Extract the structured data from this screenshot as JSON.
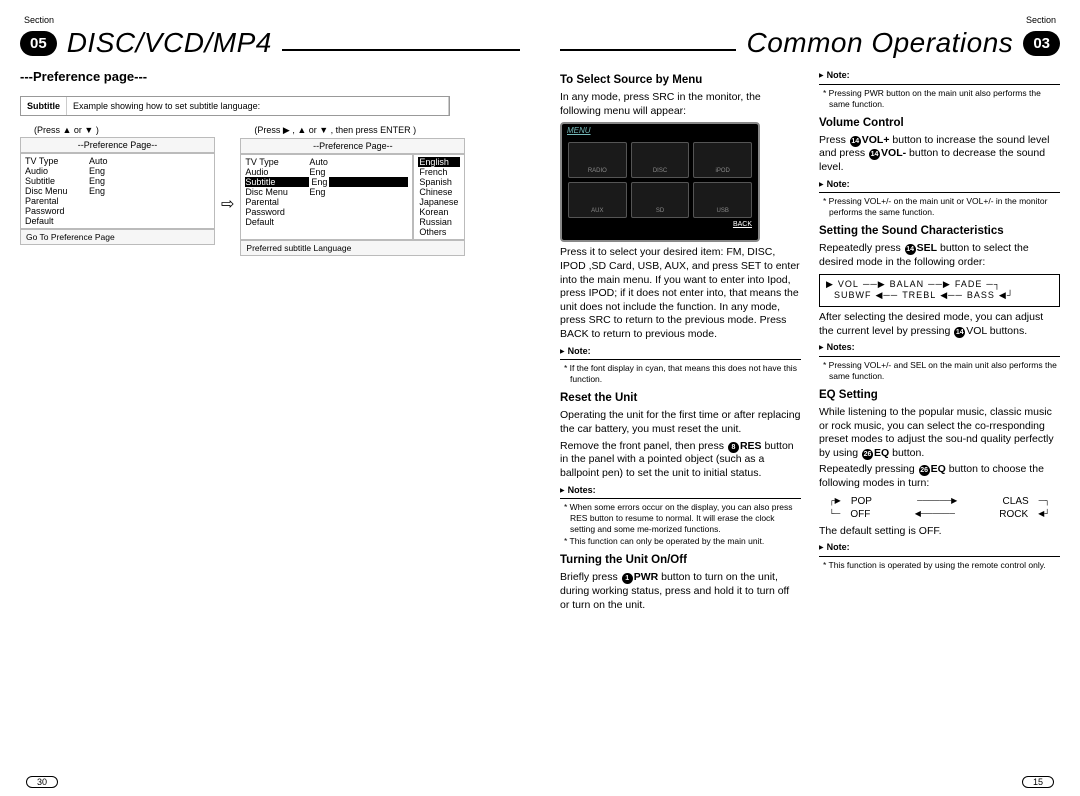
{
  "left": {
    "section_label": "Section",
    "section_number": "05",
    "title": "DISC/VCD/MP4",
    "pref_header": "---Preference page---",
    "subtitle_label": "Subtitle",
    "subtitle_desc": "Example showing how to set subtitle language:",
    "press1": "(Press ▲ or ▼ )",
    "press2": "(Press ▶ , ▲ or ▼ , then press ENTER )",
    "panel1": {
      "head": "--Preference Page--",
      "rows": [
        [
          "TV Type",
          "Auto"
        ],
        [
          "Audio",
          "Eng"
        ],
        [
          "Subtitle",
          "Eng"
        ],
        [
          "Disc Menu",
          "Eng"
        ],
        [
          "Parental",
          ""
        ],
        [
          "Password",
          ""
        ],
        [
          "Default",
          ""
        ]
      ],
      "foot": "Go To Preference Page"
    },
    "panel2": {
      "head": "--Preference Page--",
      "rows": [
        [
          "TV Type",
          "Auto"
        ],
        [
          "Audio",
          "Eng"
        ],
        [
          "Subtitle",
          "Eng"
        ],
        [
          "Disc Menu",
          "Eng"
        ],
        [
          "Parental",
          ""
        ],
        [
          "Password",
          ""
        ],
        [
          "Default",
          ""
        ]
      ],
      "foot": "Preferred subtitle Language",
      "langs": [
        "English",
        "French",
        "Spanish",
        "Chinese",
        "Japanese",
        "Korean",
        "Russian",
        "Others"
      ]
    },
    "page_num": "30"
  },
  "right": {
    "section_label": "Section",
    "section_number": "03",
    "title": "Common Operations",
    "page_num": "15",
    "col1": {
      "h1": "To Select Source by Menu",
      "p1": "In any mode, press SRC in the monitor, the following menu will appear:",
      "menu_label": "MENU",
      "tiles": [
        "RADIO",
        "DISC",
        "iPOD",
        "AUX",
        "SD",
        "USB"
      ],
      "back": "BACK",
      "p2": "Press it to select your desired item: FM, DISC, IPOD ,SD Card, USB, AUX, and press SET to enter into the main menu. If you want to enter into Ipod, press IPOD; if it does not enter into, that means the unit does not include the function. In any mode, press SRC  to return to the previous mode. Press BACK to return to previous mode.",
      "note_l": "Note:",
      "note1": "*   If the font display in cyan, that means this does not have this function.",
      "h2": "Reset the Unit",
      "p3": "Operating the unit for the first time or after replacing the car battery, you must reset the unit.",
      "p4a": "Remove the front panel, then press ",
      "p4b": " button in the panel with a pointed object (such as a ballpoint pen) to set the unit to initial status.",
      "res_num": "8",
      "res_label": "RES",
      "notes_l": "Notes:",
      "note2a": "*   When some errors occur on the display, you can also press RES button to resume to normal. It will erase the clock setting and some me-morized functions.",
      "note2b": "*   This function can only be operated by the main unit.",
      "h3": "Turning the Unit On/Off",
      "p5a": "Briefly press ",
      "p5b": " button to turn on the unit, during working status, press and hold it to turn off or turn on the unit.",
      "pwr_num": "1",
      "pwr_label": "PWR"
    },
    "col2": {
      "note_l": "Note:",
      "note0": "*   Pressing PWR button on the main unit also performs the same function.",
      "h1": "Volume Control",
      "p1a": "Press ",
      "p1b": " button to increase the sound level and press ",
      "p1c": " button to decrease the sound level.",
      "volp_num": "14",
      "volp_label": "VOL+",
      "volm_num": "14",
      "volm_label": "VOL-",
      "note1": "*   Pressing VOL+/- on the main unit or VOL+/- in the monitor performs the same function.",
      "h2": "Setting the Sound Characteristics",
      "p2a": "Repeatedly press ",
      "p2b": " button to select the desired mode in the following order:",
      "sel_num": "14",
      "sel_label": "SEL",
      "flow": {
        "r1": [
          "VOL",
          "BALAN",
          "FADE"
        ],
        "r2": [
          "SUBWF",
          "TREBL",
          "BASS"
        ]
      },
      "p3a": "After selecting the desired mode, you can adjust the current level by pressing ",
      "p3b": " buttons.",
      "vol_num": "14",
      "vol_label": "VOL",
      "notes_l": "Notes:",
      "note2": "*   Pressing VOL+/- and SEL on the main unit also performs the same function.",
      "h3": "EQ Setting",
      "p4": "While listening to the popular music, classic music or rock music, you can select the co-rresponding preset modes to adjust the sou-nd quality perfectly by using ",
      "p4b": " button.",
      "eq_num": "26",
      "eq_label": "EQ",
      "p5a": "Repeatedly pressing ",
      "p5b": " button to choose the following modes in turn:",
      "eq_modes": {
        "tl": "POP",
        "tr": "CLAS",
        "bl": "OFF",
        "br": "ROCK"
      },
      "p6": "The default setting is OFF.",
      "note3": "*   This function is operated by using the remote control only."
    }
  }
}
